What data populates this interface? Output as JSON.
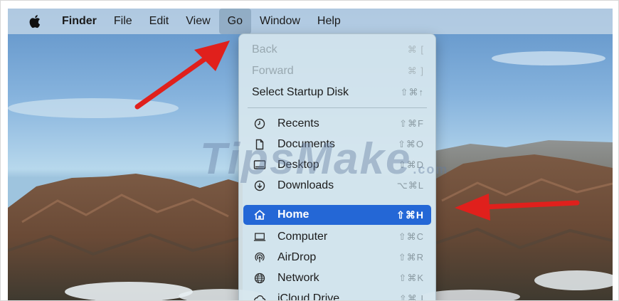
{
  "menubar": {
    "app_name": "Finder",
    "items": [
      {
        "label": "File"
      },
      {
        "label": "Edit"
      },
      {
        "label": "View"
      },
      {
        "label": "Go",
        "active": true
      },
      {
        "label": "Window"
      },
      {
        "label": "Help"
      }
    ]
  },
  "go_menu": {
    "top_items": [
      {
        "label": "Back",
        "shortcut": "⌘ [",
        "enabled": false
      },
      {
        "label": "Forward",
        "shortcut": "⌘ ]",
        "enabled": false
      },
      {
        "label": "Select Startup Disk",
        "shortcut": "⇧⌘↑",
        "enabled": true
      }
    ],
    "places": [
      {
        "label": "Recents",
        "shortcut": "⇧⌘F",
        "icon": "clock-icon"
      },
      {
        "label": "Documents",
        "shortcut": "⇧⌘O",
        "icon": "document-icon"
      },
      {
        "label": "Desktop",
        "shortcut": "⇧⌘D",
        "icon": "desktop-icon"
      },
      {
        "label": "Downloads",
        "shortcut": "⌥⌘L",
        "icon": "download-icon"
      },
      {
        "label": "Home",
        "shortcut": "⇧⌘H",
        "icon": "house-icon",
        "selected": true
      },
      {
        "label": "Computer",
        "shortcut": "⇧⌘C",
        "icon": "laptop-icon"
      },
      {
        "label": "AirDrop",
        "shortcut": "⇧⌘R",
        "icon": "airdrop-icon"
      },
      {
        "label": "Network",
        "shortcut": "⇧⌘K",
        "icon": "globe-icon"
      },
      {
        "label": "iCloud Drive",
        "shortcut": "⇧⌘ I",
        "icon": "cloud-icon"
      }
    ]
  },
  "watermark": {
    "text": "TipsMake",
    "suffix": ".com"
  },
  "colors": {
    "selection": "#2467d6",
    "arrow": "#e0201c"
  }
}
